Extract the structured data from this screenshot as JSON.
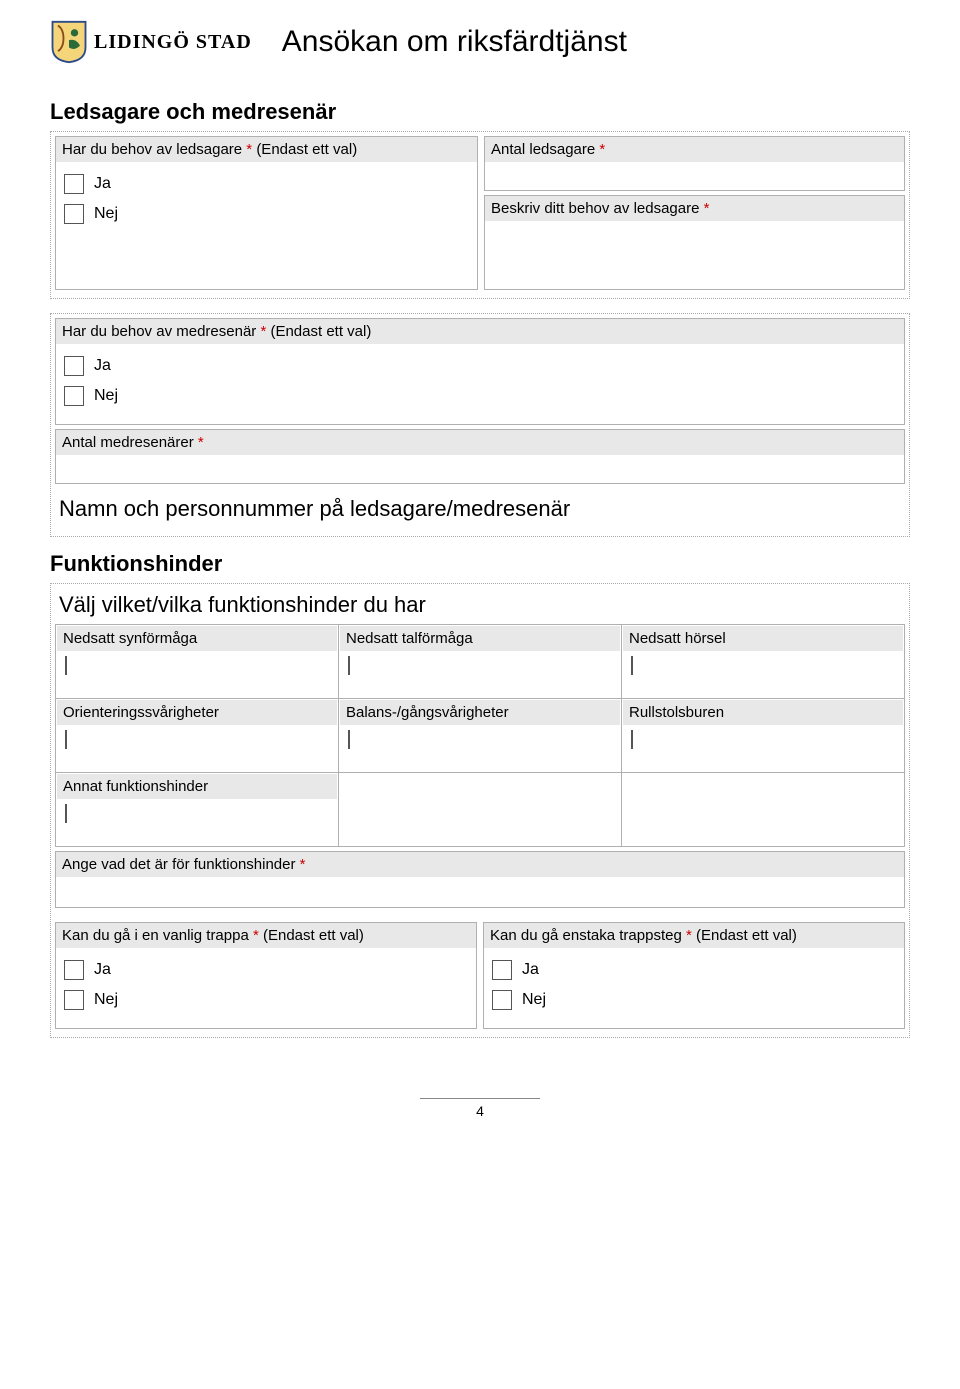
{
  "header": {
    "brand": "LIDINGÖ STAD",
    "title": "Ansökan om riksfärdtjänst"
  },
  "common": {
    "ja": "Ja",
    "nej": "Nej",
    "req": "*",
    "endast_ett_val": "(Endast ett val)"
  },
  "section1": {
    "heading": "Ledsagare och medresenär",
    "q1_label": "Har du behov av ledsagare ",
    "antal_ledsagare_label": "Antal ledsagare ",
    "beskriv_label": "Beskriv ditt behov av ledsagare ",
    "q2_label": "Har du behov av medresenär ",
    "antal_medresenarer_label": "Antal medresenärer ",
    "sub_heading": "Namn och personnummer på ledsagare/medresenär"
  },
  "section2": {
    "heading": "Funktionshinder",
    "sub_heading": "Välj vilket/vilka funktionshinder du har",
    "cells": {
      "r1c1": "Nedsatt synförmåga",
      "r1c2": "Nedsatt talförmåga",
      "r1c3": "Nedsatt hörsel",
      "r2c1": "Orienteringssvårigheter",
      "r2c2": "Balans-/gångsvårigheter",
      "r2c3": "Rullstolsburen",
      "r3c1": "Annat funktionshinder"
    },
    "ange_label": "Ange vad det är för funktionshinder ",
    "q_trappa": "Kan du gå i en vanlig trappa ",
    "q_trappsteg": "Kan du gå enstaka trappsteg "
  },
  "page_number": "4"
}
